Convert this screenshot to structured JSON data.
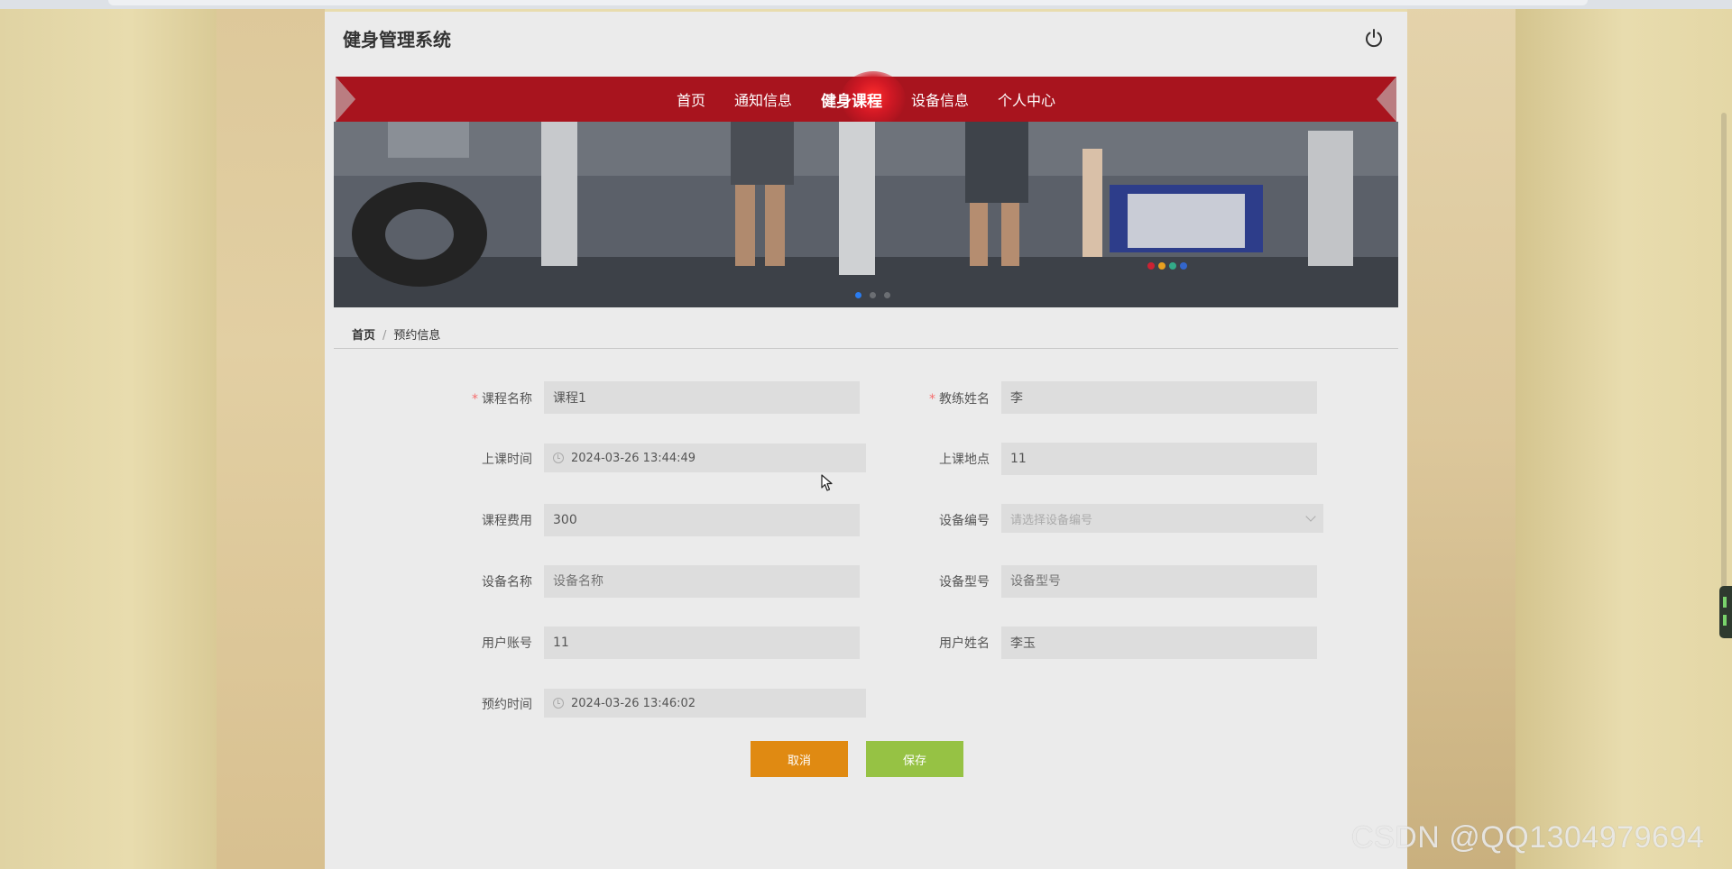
{
  "site": {
    "title": "健身管理系统",
    "logout_icon": "power-icon"
  },
  "nav": {
    "items": [
      {
        "label": "首页",
        "active": false
      },
      {
        "label": "通知信息",
        "active": false
      },
      {
        "label": "健身课程",
        "active": true
      },
      {
        "label": "设备信息",
        "active": false
      },
      {
        "label": "个人中心",
        "active": false
      }
    ],
    "ribbon_color": "#a8141e"
  },
  "banner": {
    "slides": 3,
    "active_slide": 1
  },
  "breadcrumb": {
    "home": "首页",
    "separator": "/",
    "current": "预约信息"
  },
  "form": {
    "course_name": {
      "label": "课程名称",
      "required": true,
      "value": "课程1"
    },
    "coach_name": {
      "label": "教练姓名",
      "required": true,
      "value": "李"
    },
    "class_time": {
      "label": "上课时间",
      "value": "2024-03-26 13:44:49"
    },
    "class_location": {
      "label": "上课地点",
      "value": "11"
    },
    "course_fee": {
      "label": "课程费用",
      "value": "300"
    },
    "device_no": {
      "label": "设备编号",
      "placeholder": "请选择设备编号"
    },
    "device_name": {
      "label": "设备名称",
      "placeholder": "设备名称"
    },
    "device_model": {
      "label": "设备型号",
      "placeholder": "设备型号"
    },
    "user_account": {
      "label": "用户账号",
      "value": "11"
    },
    "user_name": {
      "label": "用户姓名",
      "value": "李玉"
    },
    "booking_time": {
      "label": "预约时间",
      "value": "2024-03-26 13:46:02"
    },
    "required_mark": "*"
  },
  "buttons": {
    "cancel": "取消",
    "save": "保存"
  },
  "colors": {
    "cancel": "#e08a12",
    "save": "#96c244",
    "active_dot": "#2a7cf0"
  },
  "watermark": "CSDN @QQ1304979694"
}
